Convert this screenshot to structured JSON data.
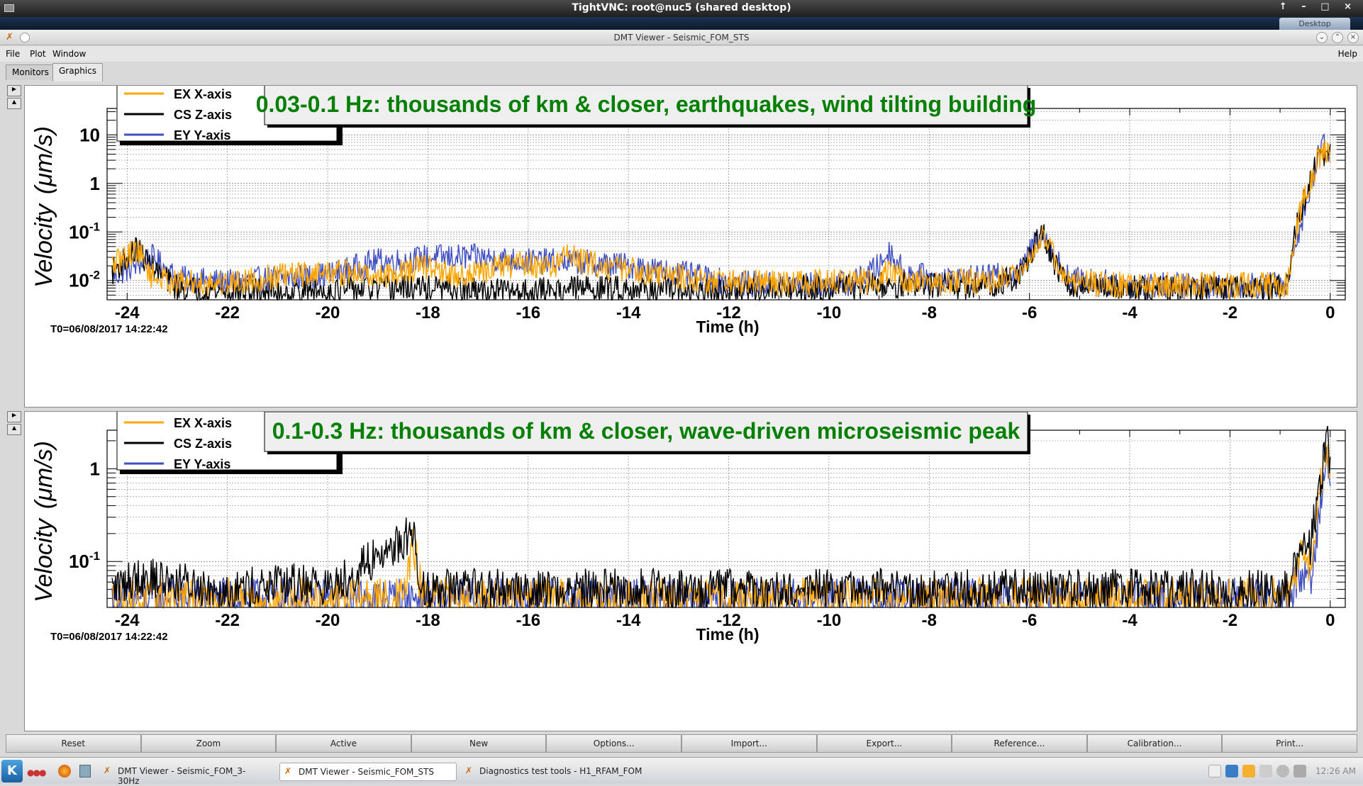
{
  "vnc": {
    "title": "TightVNC: root@nuc5 (shared desktop)",
    "desktop_tab": "Desktop",
    "controls": "↑ – □ ×"
  },
  "app": {
    "title": "DMT Viewer - Seismic_FOM_STS"
  },
  "menu": {
    "file": "File",
    "plot": "Plot",
    "window": "Window",
    "help": "Help"
  },
  "tabs": {
    "monitors": "Monitors",
    "graphics": "Graphics"
  },
  "colors": {
    "ex": "#ffa500",
    "cs": "#000000",
    "ey": "#3f4fc2",
    "title_text": "#007f00"
  },
  "plot_common": {
    "legend": [
      {
        "label": "EX X-axis",
        "color": "#ffa500"
      },
      {
        "label": "CS Z-axis",
        "color": "#000000"
      },
      {
        "label": "EY Y-axis",
        "color": "#3f4fc2"
      }
    ],
    "ylabel_word": "Velocity",
    "ylabel_unit": "(μm/s)",
    "xlabel": "Time (h)",
    "t0": "T0=06/08/2017 14:22:42"
  },
  "chart_data": [
    {
      "type": "line",
      "title": "0.03-0.1 Hz: thousands of km & closer, earthquakes, wind tilting building",
      "xlabel": "Time (h)",
      "ylabel": "Velocity (μm/s)",
      "xlim": [
        -24.4,
        0.3
      ],
      "ylim": [
        0.004,
        35
      ],
      "log_y": true,
      "grid": true,
      "legend_position": "top-left",
      "x_ticks": [
        -24,
        -22,
        -20,
        -18,
        -16,
        -14,
        -12,
        -10,
        -8,
        -6,
        -4,
        -2,
        0
      ],
      "y_ticks": [
        {
          "v": 10,
          "base": "10",
          "exp": ""
        },
        {
          "v": 1,
          "base": "1",
          "exp": ""
        },
        {
          "v": 0.1,
          "base": "10",
          "exp": "-1"
        },
        {
          "v": 0.01,
          "base": "10",
          "exp": "-2"
        }
      ],
      "series": [
        {
          "name": "EY Y-axis",
          "color": "#3f4fc2",
          "points": [
            [
              -24.3,
              0.012
            ],
            [
              -23.5,
              0.03
            ],
            [
              -23,
              0.011
            ],
            [
              -22,
              0.009
            ],
            [
              -21,
              0.011
            ],
            [
              -20,
              0.013
            ],
            [
              -19.5,
              0.018
            ],
            [
              -19,
              0.025
            ],
            [
              -18.5,
              0.025
            ],
            [
              -18,
              0.03
            ],
            [
              -17.5,
              0.03
            ],
            [
              -17,
              0.03
            ],
            [
              -16,
              0.025
            ],
            [
              -15,
              0.024
            ],
            [
              -14,
              0.02
            ],
            [
              -13,
              0.014
            ],
            [
              -12,
              0.009
            ],
            [
              -11,
              0.008
            ],
            [
              -10,
              0.008
            ],
            [
              -9.5,
              0.009
            ],
            [
              -9,
              0.02
            ],
            [
              -8.8,
              0.04
            ],
            [
              -8.5,
              0.015
            ],
            [
              -8,
              0.011
            ],
            [
              -7,
              0.011
            ],
            [
              -6.2,
              0.014
            ],
            [
              -5.9,
              0.06
            ],
            [
              -5.75,
              0.11
            ],
            [
              -5.5,
              0.03
            ],
            [
              -5.2,
              0.011
            ],
            [
              -4,
              0.008
            ],
            [
              -3,
              0.008
            ],
            [
              -2,
              0.008
            ],
            [
              -1,
              0.008
            ],
            [
              -0.85,
              0.007
            ],
            [
              -0.7,
              0.06
            ],
            [
              -0.5,
              0.3
            ],
            [
              -0.35,
              1.2
            ],
            [
              -0.2,
              5
            ],
            [
              -0.15,
              8
            ],
            [
              0,
              3
            ]
          ]
        },
        {
          "name": "CS Z-axis",
          "color": "#000000",
          "points": [
            [
              -24.3,
              0.015
            ],
            [
              -23.8,
              0.045
            ],
            [
              -23.5,
              0.018
            ],
            [
              -23,
              0.007
            ],
            [
              -22,
              0.006
            ],
            [
              -21,
              0.006
            ],
            [
              -20,
              0.006
            ],
            [
              -19,
              0.007
            ],
            [
              -18,
              0.007
            ],
            [
              -17,
              0.006
            ],
            [
              -16,
              0.006
            ],
            [
              -15,
              0.007
            ],
            [
              -14,
              0.007
            ],
            [
              -13,
              0.006
            ],
            [
              -12,
              0.006
            ],
            [
              -11,
              0.007
            ],
            [
              -10,
              0.007
            ],
            [
              -9,
              0.008
            ],
            [
              -8,
              0.008
            ],
            [
              -7,
              0.007
            ],
            [
              -6.2,
              0.012
            ],
            [
              -5.9,
              0.05
            ],
            [
              -5.75,
              0.1
            ],
            [
              -5.5,
              0.02
            ],
            [
              -5.2,
              0.008
            ],
            [
              -4,
              0.007
            ],
            [
              -3,
              0.007
            ],
            [
              -2,
              0.007
            ],
            [
              -1,
              0.007
            ],
            [
              -0.85,
              0.008
            ],
            [
              -0.7,
              0.1
            ],
            [
              -0.5,
              0.5
            ],
            [
              -0.35,
              1.5
            ],
            [
              -0.2,
              4
            ],
            [
              0,
              4
            ]
          ]
        },
        {
          "name": "EX X-axis",
          "color": "#ffa500",
          "points": [
            [
              -24.3,
              0.02
            ],
            [
              -23.8,
              0.045
            ],
            [
              -23.5,
              0.012
            ],
            [
              -23,
              0.009
            ],
            [
              -22,
              0.009
            ],
            [
              -21,
              0.012
            ],
            [
              -20,
              0.015
            ],
            [
              -19.5,
              0.014
            ],
            [
              -19,
              0.012
            ],
            [
              -18,
              0.02
            ],
            [
              -17.5,
              0.012
            ],
            [
              -17,
              0.014
            ],
            [
              -16.5,
              0.02
            ],
            [
              -16,
              0.022
            ],
            [
              -15.5,
              0.018
            ],
            [
              -15.2,
              0.04
            ],
            [
              -15,
              0.025
            ],
            [
              -14.5,
              0.02
            ],
            [
              -14,
              0.017
            ],
            [
              -13,
              0.012
            ],
            [
              -12,
              0.009
            ],
            [
              -11,
              0.009
            ],
            [
              -10,
              0.009
            ],
            [
              -9,
              0.01
            ],
            [
              -8.8,
              0.018
            ],
            [
              -8.5,
              0.01
            ],
            [
              -8,
              0.009
            ],
            [
              -7,
              0.01
            ],
            [
              -6.2,
              0.012
            ],
            [
              -5.9,
              0.05
            ],
            [
              -5.75,
              0.1
            ],
            [
              -5.5,
              0.03
            ],
            [
              -5.2,
              0.009
            ],
            [
              -4,
              0.008
            ],
            [
              -3,
              0.008
            ],
            [
              -2,
              0.008
            ],
            [
              -1,
              0.008
            ],
            [
              -0.85,
              0.008
            ],
            [
              -0.7,
              0.1
            ],
            [
              -0.5,
              0.6
            ],
            [
              -0.35,
              1.5
            ],
            [
              -0.2,
              4
            ],
            [
              0,
              5
            ]
          ]
        }
      ]
    },
    {
      "type": "line",
      "title": "0.1-0.3 Hz: thousands of km & closer, wave-driven microseismic peak",
      "xlabel": "Time (h)",
      "ylabel": "Velocity (μm/s)",
      "xlim": [
        -24.4,
        0.3
      ],
      "ylim": [
        0.032,
        2.6
      ],
      "log_y": true,
      "grid": true,
      "legend_position": "top-left",
      "x_ticks": [
        -24,
        -22,
        -20,
        -18,
        -16,
        -14,
        -12,
        -10,
        -8,
        -6,
        -4,
        -2,
        0
      ],
      "y_ticks": [
        {
          "v": 1,
          "base": "1",
          "exp": ""
        },
        {
          "v": 0.1,
          "base": "10",
          "exp": "-1"
        }
      ],
      "series": [
        {
          "name": "EY Y-axis",
          "color": "#3f4fc2",
          "points": [
            [
              -24.3,
              0.04
            ],
            [
              -20,
              0.04
            ],
            [
              -16,
              0.04
            ],
            [
              -12,
              0.04
            ],
            [
              -8,
              0.04
            ],
            [
              -4,
              0.04
            ],
            [
              -1,
              0.04
            ],
            [
              -0.8,
              0.04
            ],
            [
              -0.6,
              0.08
            ],
            [
              -0.4,
              0.06
            ],
            [
              -0.2,
              0.4
            ],
            [
              -0.05,
              1.5
            ],
            [
              0,
              0.5
            ]
          ]
        },
        {
          "name": "EX X-axis",
          "color": "#ffa500",
          "points": [
            [
              -24.3,
              0.04
            ],
            [
              -20,
              0.04
            ],
            [
              -18.5,
              0.04
            ],
            [
              -18.3,
              0.15
            ],
            [
              -18.1,
              0.04
            ],
            [
              -16,
              0.04
            ],
            [
              -12,
              0.04
            ],
            [
              -8,
              0.04
            ],
            [
              -4,
              0.04
            ],
            [
              -1,
              0.04
            ],
            [
              -0.8,
              0.04
            ],
            [
              -0.6,
              0.12
            ],
            [
              -0.4,
              0.1
            ],
            [
              -0.2,
              0.6
            ],
            [
              -0.05,
              1.8
            ],
            [
              0,
              0.6
            ]
          ]
        },
        {
          "name": "CS Z-axis",
          "color": "#000000",
          "points": [
            [
              -24.3,
              0.05
            ],
            [
              -23.8,
              0.07
            ],
            [
              -22,
              0.05
            ],
            [
              -20.2,
              0.06
            ],
            [
              -20,
              0.05
            ],
            [
              -18.3,
              0.2
            ],
            [
              -18.1,
              0.05
            ],
            [
              -16,
              0.05
            ],
            [
              -14,
              0.05
            ],
            [
              -12,
              0.05
            ],
            [
              -10,
              0.05
            ],
            [
              -8,
              0.05
            ],
            [
              -6,
              0.05
            ],
            [
              -4,
              0.05
            ],
            [
              -2,
              0.05
            ],
            [
              -1,
              0.05
            ],
            [
              -0.8,
              0.05
            ],
            [
              -0.6,
              0.18
            ],
            [
              -0.4,
              0.15
            ],
            [
              -0.2,
              0.7
            ],
            [
              -0.05,
              2.4
            ],
            [
              0,
              0.8
            ]
          ]
        }
      ]
    }
  ],
  "buttons": [
    "Reset",
    "Zoom",
    "Active",
    "New",
    "Options...",
    "Import...",
    "Export...",
    "Reference...",
    "Calibration...",
    "Print..."
  ],
  "taskbar": {
    "tasks": [
      "DMT Viewer - Seismic_FOM_3-30Hz",
      "DMT Viewer - Seismic_FOM_STS",
      "Diagnostics test tools - H1_RFAM_FOM"
    ],
    "clock": "12:26 AM"
  }
}
